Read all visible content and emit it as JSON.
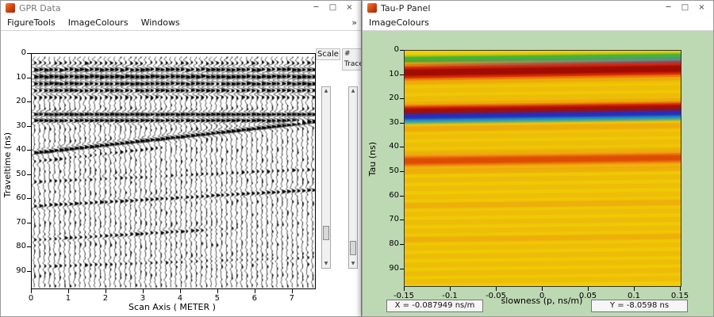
{
  "window_glyphs": {
    "minimize": "─",
    "maximize": "□",
    "close": "×"
  },
  "icons": {
    "slider_up": "▲",
    "slider_down": "▼",
    "menu_overflow": "»"
  },
  "left_window": {
    "title": "GPR Data",
    "menus": [
      "FigureTools",
      "ImageColours",
      "Windows"
    ],
    "controls": {
      "scale_label": "Scale",
      "traces_label": "#\nTraces",
      "scale_slider_frac": 0.87,
      "traces_slider_frac": 0.97
    },
    "chart_data": {
      "type": "wiggle-seismic",
      "xlabel": "Scan Axis ( METER )",
      "ylabel": "Traveltime (ns)",
      "xticks": [
        0,
        1,
        2,
        3,
        4,
        5,
        6,
        7
      ],
      "yticks": [
        0,
        10,
        20,
        30,
        40,
        50,
        60,
        70,
        80,
        90
      ],
      "xlim": [
        0,
        7.6
      ],
      "ylim": [
        0,
        97
      ],
      "n_traces": 56,
      "noise_amp": 0.55,
      "ringing": {
        "t_center": 10.5,
        "half_width": 7.5,
        "amp": 2.6,
        "period": 2.9
      },
      "events": [
        {
          "t0": 25.0,
          "slope": 0,
          "amp": 3.0
        },
        {
          "t0": 27.6,
          "slope": 0,
          "amp": 2.2
        },
        {
          "t0": 41.0,
          "slope": -1.7,
          "amp": 3.3
        },
        {
          "t0": 44.6,
          "slope": -1.7,
          "amp": 1.2,
          "x_max": 3.0
        },
        {
          "t0": 53.0,
          "slope": -0.7,
          "amp": 1.0
        },
        {
          "t0": 63.0,
          "slope": -0.9,
          "amp": 1.6
        },
        {
          "t0": 77.0,
          "slope": -0.9,
          "amp": 1.5,
          "x_max": 4.5
        },
        {
          "t0": 88.0,
          "slope": -0.5,
          "amp": 0.9
        }
      ]
    }
  },
  "right_window": {
    "title": "Tau-P Panel",
    "menus": [
      "ImageColours"
    ],
    "status": {
      "x_readout": "X = -0.087949 ns/m",
      "y_readout": "Y = -8.0598  ns"
    },
    "chart_data": {
      "type": "heatmap",
      "xlabel": "slowness (p, ns/m)",
      "ylabel": "Tau (ns)",
      "xticks": [
        "-0.15",
        "-0.1",
        "-0.05",
        "0",
        "0.05",
        "0.1",
        "0.15"
      ],
      "yticks": [
        0,
        10,
        20,
        30,
        40,
        50,
        60,
        70,
        80,
        90
      ],
      "xlim": [
        -0.15,
        0.15
      ],
      "ylim": [
        0,
        97
      ],
      "background_color": "#f1cf05",
      "bands": [
        {
          "tauL": 3.6,
          "tauR": 2.3,
          "h": 1.0,
          "color": "#2fae3c",
          "alpha": 0.8
        },
        {
          "tauL": 5.4,
          "tauR": 4.0,
          "h": 1.0,
          "color": "#18b4c4",
          "alpha": 0.75,
          "fade": "right"
        },
        {
          "tauL": 6.6,
          "tauR": 5.2,
          "h": 0.8,
          "color": "#2438c8",
          "alpha": 0.6,
          "fade": "right"
        },
        {
          "tauL": 9.0,
          "tauR": 7.4,
          "h": 2.4,
          "color": "#e62e0e",
          "alpha": 0.95
        },
        {
          "tauL": 9.0,
          "tauR": 7.4,
          "h": 1.2,
          "color": "#9e0c00",
          "alpha": 1
        },
        {
          "tauL": 13.5,
          "tauR": 12.2,
          "h": 0.9,
          "color": "#eaa810",
          "alpha": 0.3
        },
        {
          "tauL": 16.5,
          "tauR": 15.2,
          "h": 0.9,
          "color": "#eaa810",
          "alpha": 0.3
        },
        {
          "tauL": 19.8,
          "tauR": 18.5,
          "h": 0.9,
          "color": "#eaa810",
          "alpha": 0.35
        },
        {
          "tauL": 25.1,
          "tauR": 23.6,
          "h": 2.0,
          "color": "#e62e0e",
          "alpha": 0.9
        },
        {
          "tauL": 25.1,
          "tauR": 23.6,
          "h": 1.1,
          "color": "#a80e00",
          "alpha": 1
        },
        {
          "tauL": 27.7,
          "tauR": 26.2,
          "h": 1.3,
          "color": "#1e2cc4",
          "alpha": 0.95
        },
        {
          "tauL": 29.1,
          "tauR": 27.6,
          "h": 0.7,
          "color": "#18b4c4",
          "alpha": 0.55
        },
        {
          "tauL": 32.3,
          "tauR": 30.9,
          "h": 1.0,
          "color": "#ec9810",
          "alpha": 0.5
        },
        {
          "tauL": 35.6,
          "tauR": 34.2,
          "h": 0.9,
          "color": "#eaa810",
          "alpha": 0.3
        },
        {
          "tauL": 38.9,
          "tauR": 37.5,
          "h": 0.9,
          "color": "#eaa810",
          "alpha": 0.3
        },
        {
          "tauL": 41.9,
          "tauR": 40.5,
          "h": 0.9,
          "color": "#eaa810",
          "alpha": 0.35
        },
        {
          "tauL": 45.5,
          "tauR": 44.1,
          "h": 1.9,
          "color": "#f07818",
          "alpha": 0.8
        },
        {
          "tauL": 45.5,
          "tauR": 44.1,
          "h": 1.0,
          "color": "#dc4a00",
          "alpha": 0.95
        },
        {
          "tauL": 49.9,
          "tauR": 48.5,
          "h": 0.9,
          "color": "#ec9810",
          "alpha": 0.45
        },
        {
          "tauL": 53.4,
          "tauR": 52.0,
          "h": 0.9,
          "color": "#eaa810",
          "alpha": 0.35
        },
        {
          "tauL": 56.9,
          "tauR": 55.5,
          "h": 0.9,
          "color": "#eaa810",
          "alpha": 0.3
        },
        {
          "tauL": 60.4,
          "tauR": 59.0,
          "h": 0.9,
          "color": "#eaa810",
          "alpha": 0.3
        },
        {
          "tauL": 63.9,
          "tauR": 62.5,
          "h": 1.0,
          "color": "#ec9810",
          "alpha": 0.45
        },
        {
          "tauL": 67.4,
          "tauR": 66.0,
          "h": 0.9,
          "color": "#eaa810",
          "alpha": 0.3
        },
        {
          "tauL": 70.9,
          "tauR": 69.5,
          "h": 0.9,
          "color": "#eaa810",
          "alpha": 0.35
        },
        {
          "tauL": 74.4,
          "tauR": 73.0,
          "h": 0.9,
          "color": "#eaa810",
          "alpha": 0.3
        },
        {
          "tauL": 77.9,
          "tauR": 76.5,
          "h": 1.0,
          "color": "#ec9810",
          "alpha": 0.45
        },
        {
          "tauL": 81.4,
          "tauR": 80.0,
          "h": 0.9,
          "color": "#eaa810",
          "alpha": 0.3
        },
        {
          "tauL": 84.9,
          "tauR": 83.5,
          "h": 0.9,
          "color": "#eaa810",
          "alpha": 0.35
        },
        {
          "tauL": 88.4,
          "tauR": 87.0,
          "h": 0.9,
          "color": "#eaa810",
          "alpha": 0.3
        },
        {
          "tauL": 91.9,
          "tauR": 90.5,
          "h": 0.9,
          "color": "#eaa810",
          "alpha": 0.35
        },
        {
          "tauL": 95.2,
          "tauR": 93.8,
          "h": 0.9,
          "color": "#eaa810",
          "alpha": 0.3
        }
      ]
    }
  }
}
